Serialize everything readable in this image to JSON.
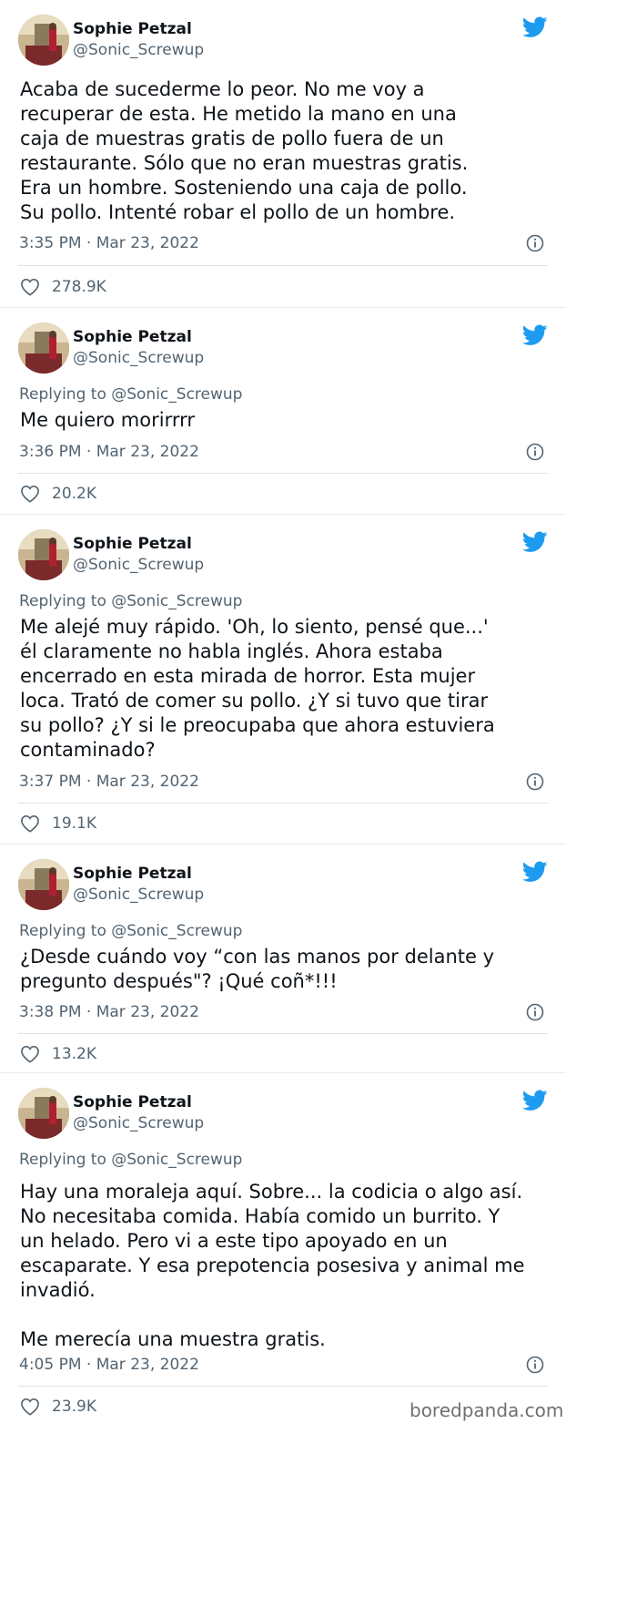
{
  "author": {
    "name": "Sophie Petzal",
    "handle": "@Sonic_Screwup"
  },
  "tweets": [
    {
      "replying": "",
      "text": "Acaba de sucederme lo peor. No me voy a\nrecuperar de esta. He metido la mano en una\ncaja de muestras gratis de pollo fuera de un\nrestaurante. Sólo que no eran muestras gratis.\nEra un hombre. Sosteniendo una caja de pollo.\nSu pollo. Intenté robar el pollo de un hombre.",
      "time": "3:35 PM · Mar 23, 2022",
      "likes": "278.9K"
    },
    {
      "replying": "Replying to @Sonic_Screwup",
      "text": "Me quiero morirrrr",
      "time": "3:36 PM · Mar 23, 2022",
      "likes": "20.2K"
    },
    {
      "replying": "Replying to @Sonic_Screwup",
      "text": "Me alejé muy rápido. 'Oh, lo siento, pensé que...'\nél claramente no habla inglés. Ahora estaba\nencerrado en esta mirada de horror. Esta mujer\nloca. Trató de comer su pollo. ¿Y si tuvo que tirar\nsu pollo? ¿Y si le preocupaba que ahora estuviera\ncontaminado?",
      "time": "3:37 PM · Mar 23, 2022",
      "likes": "19.1K"
    },
    {
      "replying": "Replying to @Sonic_Screwup",
      "text": "¿Desde cuándo voy “con las manos por delante y\npregunto después\"? ¡Qué coñ*!!!",
      "time": "3:38 PM · Mar 23, 2022",
      "likes": "13.2K"
    },
    {
      "replying": "Replying to @Sonic_Screwup",
      "text": "Hay una moraleja aquí. Sobre... la codicia o algo así.\nNo necesitaba comida. Había comido un burrito. Y\nun helado. Pero vi a este tipo apoyado en un\nescaparate. Y esa prepotencia posesiva y animal me\ninvadió.\n\nMe merecía una muestra gratis.",
      "time": "4:05 PM · Mar 23, 2022",
      "likes": "23.9K"
    }
  ],
  "watermark": "boredpanda.com",
  "colors": {
    "twitter_blue": "#1d9bf0",
    "secondary_text": "#536471"
  },
  "icons": [
    "avatar",
    "twitter-bird-icon",
    "info-icon",
    "heart-icon"
  ]
}
